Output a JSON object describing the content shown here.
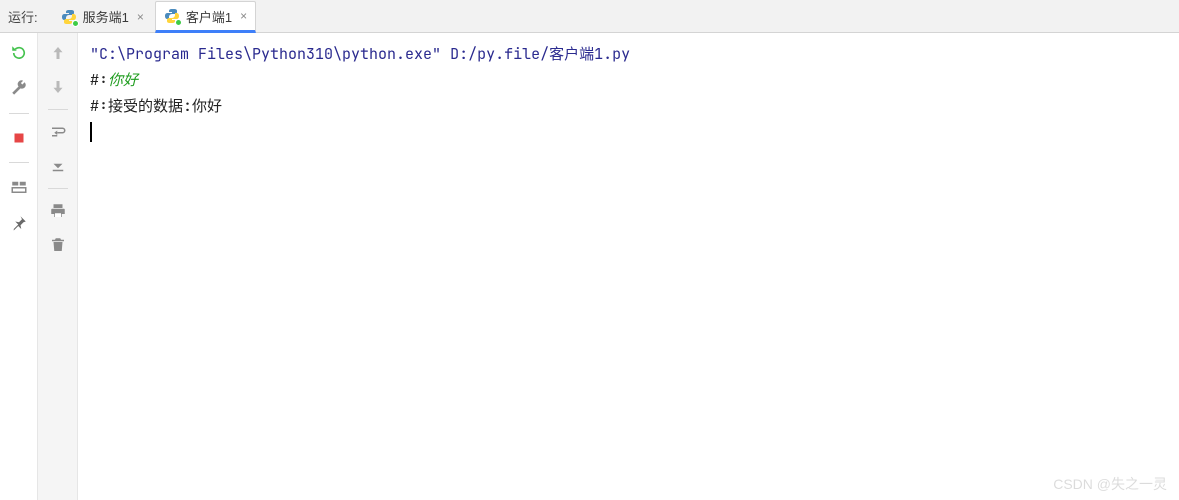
{
  "topbar": {
    "run_label": "运行:"
  },
  "tabs": [
    {
      "label": "服务端1",
      "active": false
    },
    {
      "label": "客户端1",
      "active": true
    }
  ],
  "gutter1": {
    "rerun": "rerun-icon",
    "wrench": "wrench-icon",
    "stop": "stop-icon",
    "layout": "layout-icon",
    "pin": "pin-icon"
  },
  "gutter2": {
    "up": "arrow-up-icon",
    "down": "arrow-down-icon",
    "softwrap": "softwrap-icon",
    "scrollend": "scroll-to-end-icon",
    "print": "print-icon",
    "trash": "trash-icon"
  },
  "console": {
    "cmd_quote1": "\"",
    "cmd_path": "C:\\Program Files\\Python310\\python.exe",
    "cmd_quote2": "\"",
    "cmd_space": " ",
    "arg_path": "D:/py.file/客户端1.py",
    "line2_prompt": "#:",
    "line2_input": "你好",
    "line3_prompt": "#:",
    "line3_text": "接受的数据:你好"
  },
  "watermark": "CSDN @失之一灵"
}
